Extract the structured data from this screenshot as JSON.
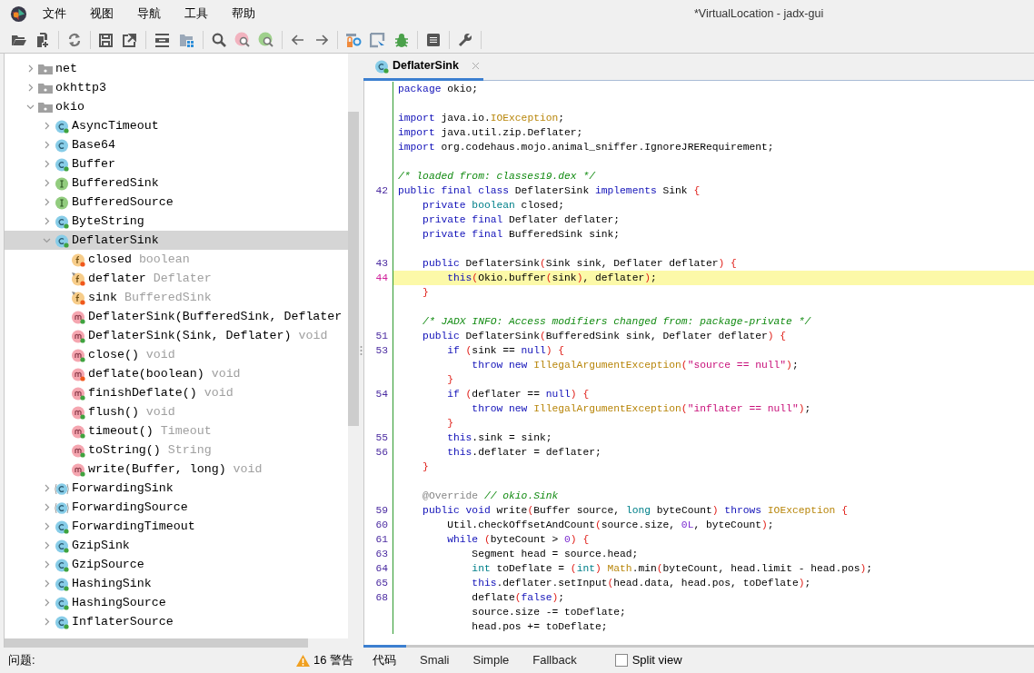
{
  "window": {
    "title": "*VirtualLocation - jadx-gui"
  },
  "menu": [
    "文件",
    "视图",
    "导航",
    "工具",
    "帮助"
  ],
  "tree": [
    {
      "label": "net",
      "kind": "folder",
      "expanded": false,
      "selected": false
    },
    {
      "label": "okhttp3",
      "kind": "folder",
      "expanded": false,
      "selected": false
    },
    {
      "label": "okio",
      "kind": "folder",
      "expanded": true,
      "selected": false,
      "children": [
        {
          "label": "AsyncTimeout",
          "kind": "class",
          "expanded": false,
          "selected": false
        },
        {
          "label": "Base64",
          "kind": "class_plain",
          "expanded": false,
          "selected": false
        },
        {
          "label": "Buffer",
          "kind": "class",
          "expanded": false,
          "selected": false
        },
        {
          "label": "BufferedSink",
          "kind": "interface",
          "expanded": false,
          "selected": false
        },
        {
          "label": "BufferedSource",
          "kind": "interface",
          "expanded": false,
          "selected": false
        },
        {
          "label": "ByteString",
          "kind": "class",
          "expanded": false,
          "selected": false
        },
        {
          "label": "DeflaterSink",
          "kind": "class",
          "expanded": true,
          "selected": true,
          "children": [
            {
              "label": "closed",
              "detail": "boolean",
              "kind": "field",
              "selected": false
            },
            {
              "label": "deflater",
              "detail": "Deflater",
              "kind": "field_final",
              "selected": false
            },
            {
              "label": "sink",
              "detail": "BufferedSink",
              "kind": "field_final",
              "selected": false
            },
            {
              "label": "DeflaterSink(BufferedSink, Deflater",
              "kind": "method",
              "selected": false
            },
            {
              "label": "DeflaterSink(Sink, Deflater)",
              "detail": "void",
              "kind": "method",
              "selected": false
            },
            {
              "label": "close()",
              "detail": "void",
              "kind": "method",
              "selected": false
            },
            {
              "label": "deflate(boolean)",
              "detail": "void",
              "kind": "method_private",
              "selected": false
            },
            {
              "label": "finishDeflate()",
              "detail": "void",
              "kind": "method",
              "selected": false
            },
            {
              "label": "flush()",
              "detail": "void",
              "kind": "method",
              "selected": false
            },
            {
              "label": "timeout()",
              "detail": "Timeout",
              "kind": "method",
              "selected": false
            },
            {
              "label": "toString()",
              "detail": "String",
              "kind": "method",
              "selected": false
            },
            {
              "label": "write(Buffer, long)",
              "detail": "void",
              "kind": "method",
              "selected": false
            }
          ]
        },
        {
          "label": "ForwardingSink",
          "kind": "abstract_class",
          "expanded": false,
          "selected": false
        },
        {
          "label": "ForwardingSource",
          "kind": "abstract_class",
          "expanded": false,
          "selected": false
        },
        {
          "label": "ForwardingTimeout",
          "kind": "class",
          "expanded": false,
          "selected": false
        },
        {
          "label": "GzipSink",
          "kind": "class",
          "expanded": false,
          "selected": false
        },
        {
          "label": "GzipSource",
          "kind": "class",
          "expanded": false,
          "selected": false
        },
        {
          "label": "HashingSink",
          "kind": "class",
          "expanded": false,
          "selected": false
        },
        {
          "label": "HashingSource",
          "kind": "class",
          "expanded": false,
          "selected": false
        },
        {
          "label": "InflaterSource",
          "kind": "class",
          "expanded": false,
          "selected": false
        }
      ]
    }
  ],
  "editor": {
    "tabs": [
      {
        "label": "DeflaterSink",
        "kind": "class",
        "selected": true
      }
    ],
    "blocks": [
      {
        "lines": [
          {
            "tokens": [
              {
                "kind": "kw",
                "text": "package"
              },
              {
                "kind": "p",
                "text": " okio;"
              }
            ]
          }
        ]
      },
      {
        "lines": [
          {
            "tokens": [
              {
                "kind": "kw",
                "text": "import"
              },
              {
                "kind": "p",
                "text": " java.io."
              },
              {
                "kind": "cl",
                "text": "IOException"
              },
              {
                "kind": "p",
                "text": ";"
              }
            ]
          },
          {
            "tokens": [
              {
                "kind": "kw",
                "text": "import"
              },
              {
                "kind": "p",
                "text": " java.util.zip.Deflater;"
              }
            ]
          },
          {
            "tokens": [
              {
                "kind": "kw",
                "text": "import"
              },
              {
                "kind": "p",
                "text": " org.codehaus.mojo.animal_sniffer.IgnoreJRERequirement;"
              }
            ]
          }
        ]
      },
      {
        "lines": [
          {
            "tokens": [
              {
                "kind": "cm",
                "text": "/* loaded from: classes19.dex */"
              }
            ]
          },
          {
            "num": "42",
            "tokens": [
              {
                "kind": "kw",
                "text": "public final class"
              },
              {
                "kind": "p",
                "text": " DeflaterSink "
              },
              {
                "kind": "kw",
                "text": "implements"
              },
              {
                "kind": "p",
                "text": " Sink "
              },
              {
                "kind": "br",
                "text": "{"
              }
            ]
          },
          {
            "tokens": [
              {
                "kind": "kw",
                "text": "    private "
              },
              {
                "kind": "ty",
                "text": "boolean"
              },
              {
                "kind": "p",
                "text": " closed;"
              }
            ]
          },
          {
            "tokens": [
              {
                "kind": "kw",
                "text": "    private final"
              },
              {
                "kind": "p",
                "text": " Deflater deflater;"
              }
            ]
          },
          {
            "tokens": [
              {
                "kind": "kw",
                "text": "    private final"
              },
              {
                "kind": "p",
                "text": " BufferedSink sink;"
              }
            ]
          }
        ]
      },
      {
        "lines": [
          {
            "num": "43",
            "tokens": [
              {
                "kind": "kw",
                "text": "    public"
              },
              {
                "kind": "p",
                "text": " DeflaterSink"
              },
              {
                "kind": "br",
                "text": "("
              },
              {
                "kind": "p",
                "text": "Sink sink, Deflater deflater"
              },
              {
                "kind": "br",
                "text": ") {"
              }
            ]
          },
          {
            "num": "44",
            "highlighted": true,
            "tokens": [
              {
                "kind": "kw",
                "text": "        this"
              },
              {
                "kind": "br",
                "text": "("
              },
              {
                "kind": "p",
                "text": "Okio.buffer"
              },
              {
                "kind": "br",
                "text": "("
              },
              {
                "kind": "p",
                "text": "sink"
              },
              {
                "kind": "br",
                "text": ")"
              },
              {
                "kind": "p",
                "text": ", deflater"
              },
              {
                "kind": "br",
                "text": ")"
              },
              {
                "kind": "p",
                "text": ";"
              }
            ]
          },
          {
            "tokens": [
              {
                "kind": "br",
                "text": "    }"
              }
            ]
          }
        ]
      },
      {
        "lines": [
          {
            "tokens": [
              {
                "kind": "cm",
                "text": "    /* JADX INFO: Access modifiers changed from: package-private */"
              }
            ]
          },
          {
            "num": "51",
            "tokens": [
              {
                "kind": "kw",
                "text": "    public"
              },
              {
                "kind": "p",
                "text": " DeflaterSink"
              },
              {
                "kind": "br",
                "text": "("
              },
              {
                "kind": "p",
                "text": "BufferedSink sink, Deflater deflater"
              },
              {
                "kind": "br",
                "text": ") {"
              }
            ]
          },
          {
            "num": "53",
            "tokens": [
              {
                "kind": "kw",
                "text": "        if "
              },
              {
                "kind": "br",
                "text": "("
              },
              {
                "kind": "p",
                "text": "sink == "
              },
              {
                "kind": "kw",
                "text": "null"
              },
              {
                "kind": "br",
                "text": ") {"
              }
            ]
          },
          {
            "tokens": [
              {
                "kind": "kw",
                "text": "            throw new "
              },
              {
                "kind": "cl",
                "text": "IllegalArgumentException"
              },
              {
                "kind": "br",
                "text": "("
              },
              {
                "kind": "st",
                "text": "\"source == null\""
              },
              {
                "kind": "br",
                "text": ")"
              },
              {
                "kind": "p",
                "text": ";"
              }
            ]
          },
          {
            "tokens": [
              {
                "kind": "br",
                "text": "        }"
              }
            ]
          },
          {
            "num": "54",
            "tokens": [
              {
                "kind": "kw",
                "text": "        if "
              },
              {
                "kind": "br",
                "text": "("
              },
              {
                "kind": "p",
                "text": "deflater == "
              },
              {
                "kind": "kw",
                "text": "null"
              },
              {
                "kind": "br",
                "text": ") {"
              }
            ]
          },
          {
            "tokens": [
              {
                "kind": "kw",
                "text": "            throw new "
              },
              {
                "kind": "cl",
                "text": "IllegalArgumentException"
              },
              {
                "kind": "br",
                "text": "("
              },
              {
                "kind": "st",
                "text": "\"inflater == null\""
              },
              {
                "kind": "br",
                "text": ")"
              },
              {
                "kind": "p",
                "text": ";"
              }
            ]
          },
          {
            "tokens": [
              {
                "kind": "br",
                "text": "        }"
              }
            ]
          },
          {
            "num": "55",
            "tokens": [
              {
                "kind": "kw",
                "text": "        this"
              },
              {
                "kind": "p",
                "text": ".sink = sink;"
              }
            ]
          },
          {
            "num": "56",
            "tokens": [
              {
                "kind": "kw",
                "text": "        this"
              },
              {
                "kind": "p",
                "text": ".deflater = deflater;"
              }
            ]
          },
          {
            "tokens": [
              {
                "kind": "br",
                "text": "    }"
              }
            ]
          }
        ]
      },
      {
        "lines": [
          {
            "tokens": [
              {
                "kind": "an",
                "text": "    @Override "
              },
              {
                "kind": "cm",
                "text": "// okio.Sink"
              }
            ]
          },
          {
            "num": "59",
            "tokens": [
              {
                "kind": "kw",
                "text": "    public void"
              },
              {
                "kind": "p",
                "text": " write"
              },
              {
                "kind": "br",
                "text": "("
              },
              {
                "kind": "p",
                "text": "Buffer source, "
              },
              {
                "kind": "ty",
                "text": "long"
              },
              {
                "kind": "p",
                "text": " byteCount"
              },
              {
                "kind": "br",
                "text": ") "
              },
              {
                "kind": "kw",
                "text": "throws "
              },
              {
                "kind": "cl",
                "text": "IOException"
              },
              {
                "kind": "br",
                "text": " {"
              }
            ]
          },
          {
            "num": "60",
            "tokens": [
              {
                "kind": "p",
                "text": "        Util.checkOffsetAndCount"
              },
              {
                "kind": "br",
                "text": "("
              },
              {
                "kind": "p",
                "text": "source.size, "
              },
              {
                "kind": "nu",
                "text": "0L"
              },
              {
                "kind": "p",
                "text": ", byteCount"
              },
              {
                "kind": "br",
                "text": ")"
              },
              {
                "kind": "p",
                "text": ";"
              }
            ]
          },
          {
            "num": "61",
            "tokens": [
              {
                "kind": "kw",
                "text": "        while "
              },
              {
                "kind": "br",
                "text": "("
              },
              {
                "kind": "p",
                "text": "byteCount > "
              },
              {
                "kind": "nu",
                "text": "0"
              },
              {
                "kind": "br",
                "text": ") {"
              }
            ]
          },
          {
            "num": "63",
            "tokens": [
              {
                "kind": "p",
                "text": "            Segment head = source.head;"
              }
            ]
          },
          {
            "num": "64",
            "tokens": [
              {
                "kind": "ty",
                "text": "            int"
              },
              {
                "kind": "p",
                "text": " toDeflate = "
              },
              {
                "kind": "br",
                "text": "("
              },
              {
                "kind": "ty",
                "text": "int"
              },
              {
                "kind": "br",
                "text": ") "
              },
              {
                "kind": "cl",
                "text": "Math"
              },
              {
                "kind": "p",
                "text": ".min"
              },
              {
                "kind": "br",
                "text": "("
              },
              {
                "kind": "p",
                "text": "byteCount, head.limit - head.pos"
              },
              {
                "kind": "br",
                "text": ")"
              },
              {
                "kind": "p",
                "text": ";"
              }
            ]
          },
          {
            "num": "65",
            "tokens": [
              {
                "kind": "kw",
                "text": "            this"
              },
              {
                "kind": "p",
                "text": ".deflater.setInput"
              },
              {
                "kind": "br",
                "text": "("
              },
              {
                "kind": "p",
                "text": "head.data, head.pos, toDeflate"
              },
              {
                "kind": "br",
                "text": ")"
              },
              {
                "kind": "p",
                "text": ";"
              }
            ]
          },
          {
            "num": "68",
            "tokens": [
              {
                "kind": "p",
                "text": "            deflate"
              },
              {
                "kind": "br",
                "text": "("
              },
              {
                "kind": "kw",
                "text": "false"
              },
              {
                "kind": "br",
                "text": ")"
              },
              {
                "kind": "p",
                "text": ";"
              }
            ]
          },
          {
            "tokens": [
              {
                "kind": "p",
                "text": "            source.size -= toDeflate;"
              }
            ]
          },
          {
            "tokens": [
              {
                "kind": "p",
                "text": "            head.pos += toDeflate;"
              }
            ]
          }
        ]
      }
    ]
  },
  "view_tabs": [
    {
      "label": "代码",
      "selected": true
    },
    {
      "label": "Smali",
      "selected": false
    },
    {
      "label": "Simple",
      "selected": false
    },
    {
      "label": "Fallback",
      "selected": false
    }
  ],
  "split_view": {
    "label": "Split view",
    "checked": false
  },
  "status_bar": {
    "problems": "问题:",
    "warnings": "16 警告"
  }
}
